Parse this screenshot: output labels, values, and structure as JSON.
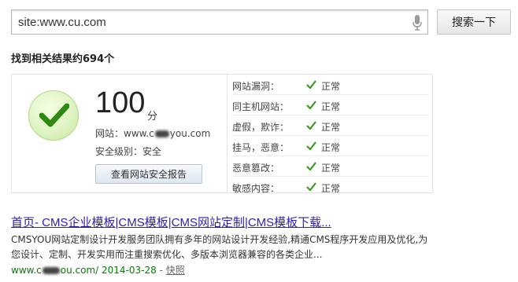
{
  "search": {
    "query": "site:www.cu.com",
    "button_label": "搜索一下"
  },
  "results_summary": "找到相关结果约694个",
  "security": {
    "score": "100",
    "score_unit": "分",
    "site_label": "网站：",
    "site_prefix": "www.c",
    "site_suffix": "you.com",
    "level_label": "安全级别：",
    "level_value": "安全",
    "report_button": "查看网站安全报告",
    "checks": [
      {
        "name": "网站漏洞：",
        "status": "正常"
      },
      {
        "name": "同主机网站：",
        "status": "正常"
      },
      {
        "name": "虚假，欺诈：",
        "status": "正常"
      },
      {
        "name": "挂马，恶意：",
        "status": "正常"
      },
      {
        "name": "恶意篡改：",
        "status": "正常"
      },
      {
        "name": "敏感内容：",
        "status": "正常"
      }
    ]
  },
  "result": {
    "title": "首页- CMS企业模板|CMS模板|CMS网站定制|CMS模板下载...",
    "snippet": "CMSYOU网站定制设计开发服务团队拥有多年的网站设计开发经验,精通CMS程序开发应用及优化,为您设计、定制、开发实用而注重搜索优化、多版本浏览器兼容的各类企业...",
    "url_prefix": "www.c",
    "url_suffix": "ou.com/",
    "date": "2014-03-28",
    "separator": "-",
    "snapshot": "快照"
  },
  "colors": {
    "check_green": "#3a9a1c",
    "title_link": "#2f1fa8",
    "url_green": "#008000"
  },
  "icons": [
    "microphone-icon",
    "safe-checkmark-icon",
    "check-icon"
  ]
}
